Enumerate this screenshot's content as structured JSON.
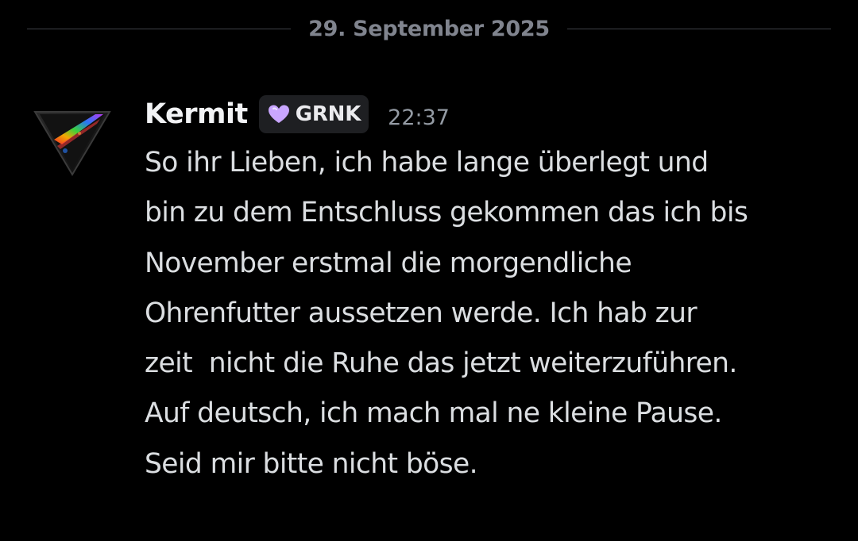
{
  "date_divider": {
    "label": "29. September 2025"
  },
  "message": {
    "author": {
      "name": "Kermit",
      "avatar_icon": "rainbow-triangle-avatar-icon"
    },
    "tag": {
      "icon": "purple-heart-icon",
      "label": "GRNK",
      "icon_color": "#c9a6ff"
    },
    "timestamp": "22:37",
    "lines": [
      "So ihr Lieben, ich habe lange überlegt und",
      "bin zu dem Entschluss gekommen das ich bis",
      "November erstmal die morgendliche",
      "Ohrenfutter aussetzen werde. Ich hab zur",
      "zeit  nicht die Ruhe das jetzt weiterzuführen.",
      "Auf deutsch, ich mach mal ne kleine Pause.",
      "Seid mir bitte nicht böse."
    ]
  },
  "colors": {
    "background": "#000000",
    "text": "#dbdee1",
    "muted": "#949ba4",
    "divider": "#3f4147"
  }
}
